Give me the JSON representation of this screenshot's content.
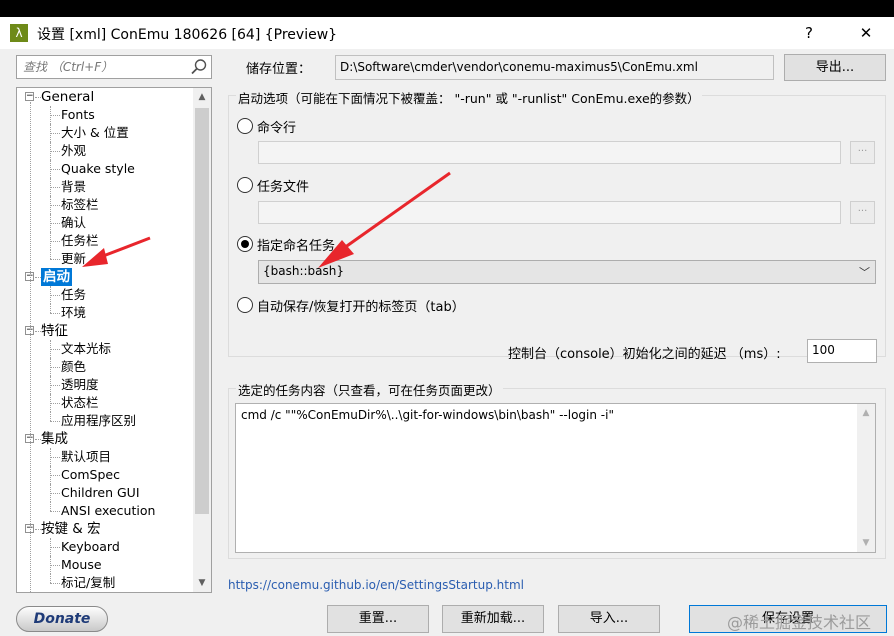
{
  "window": {
    "title": "设置 [xml] ConEmu 180626 [64] {Preview}",
    "help_label": "?",
    "close_label": "✕"
  },
  "search": {
    "placeholder": "查找 （Ctrl+F）"
  },
  "tree": {
    "items": [
      {
        "label": "General",
        "level": 0,
        "expander": "−"
      },
      {
        "label": "Fonts",
        "level": 1
      },
      {
        "label": "大小 & 位置",
        "level": 1
      },
      {
        "label": "外观",
        "level": 1
      },
      {
        "label": "Quake style",
        "level": 1
      },
      {
        "label": "背景",
        "level": 1
      },
      {
        "label": "标签栏",
        "level": 1
      },
      {
        "label": "确认",
        "level": 1
      },
      {
        "label": "任务栏",
        "level": 1
      },
      {
        "label": "更新",
        "level": 1
      },
      {
        "label": "启动",
        "level": 0,
        "expander": "−",
        "selected": true
      },
      {
        "label": "任务",
        "level": 1
      },
      {
        "label": "环境",
        "level": 1
      },
      {
        "label": "特征",
        "level": 0,
        "expander": "−"
      },
      {
        "label": "文本光标",
        "level": 1
      },
      {
        "label": "颜色",
        "level": 1
      },
      {
        "label": "透明度",
        "level": 1
      },
      {
        "label": "状态栏",
        "level": 1
      },
      {
        "label": "应用程序区别",
        "level": 1
      },
      {
        "label": "集成",
        "level": 0,
        "expander": "−"
      },
      {
        "label": "默认项目",
        "level": 1
      },
      {
        "label": "ComSpec",
        "level": 1
      },
      {
        "label": "Children GUI",
        "level": 1
      },
      {
        "label": "ANSI execution",
        "level": 1
      },
      {
        "label": "按键 & 宏",
        "level": 0,
        "expander": "−"
      },
      {
        "label": "Keyboard",
        "level": 1
      },
      {
        "label": "Mouse",
        "level": 1
      },
      {
        "label": "标记/复制",
        "level": 1
      }
    ]
  },
  "storage": {
    "label": "储存位置：",
    "path": "D:\\Software\\cmder\\vendor\\conemu-maximus5\\ConEmu.xml",
    "export_label": "导出..."
  },
  "startup": {
    "group_title": "启动选项（可能在下面情况下被覆盖： \"-run\" 或 \"-runlist\" ConEmu.exe的参数）",
    "cmdline_label": "命令行",
    "taskfile_label": "任务文件",
    "named_task_label": "指定命名任务",
    "named_task_value": "{bash::bash}",
    "autosave_label": "自动保存/恢复打开的标签页（tab）",
    "browse_label": "...",
    "selected_option": "named_task",
    "delay_label": "控制台（console）初始化之间的延迟 （ms）:",
    "delay_value": "100"
  },
  "task_content": {
    "group_title": "选定的任务内容（只查看，可在任务页面更改）",
    "text": "cmd /c \"\"%ConEmuDir%\\..\\git-for-windows\\bin\\bash\" --login -i\""
  },
  "help_link": "https://conemu.github.io/en/SettingsStartup.html",
  "footer": {
    "donate_label": "Donate",
    "reset_label": "重置...",
    "reload_label": "重新加载...",
    "import_label": "导入...",
    "save_label": "保存设置"
  },
  "watermark": "@稀土掘金技术社区",
  "colors": {
    "selection": "#0078d7",
    "annotation_arrow": "#e8262c",
    "app_icon": "#6e8a18"
  }
}
